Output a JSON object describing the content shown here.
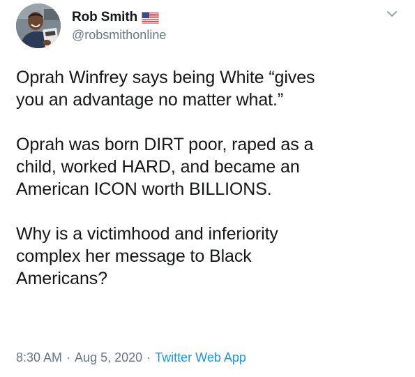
{
  "author": {
    "display_name": "Rob Smith",
    "handle": "@robsmithonline",
    "badge_icon": "us-flag-icon",
    "avatar_icon": "profile-photo"
  },
  "menu_icon": "chevron-down-icon",
  "tweet": {
    "paragraphs": [
      "Oprah Winfrey says being White “gives\nyou an advantage no matter what.”",
      "Oprah was born DIRT poor, raped as a\nchild, worked HARD, and became an\nAmerican ICON worth BILLIONS.",
      "Why is a victimhood and inferiority\ncomplex her message to Black\nAmericans?"
    ]
  },
  "meta": {
    "time": "8:30 AM",
    "separator": "·",
    "date": "Aug 5, 2020",
    "source": "Twitter Web App"
  },
  "colors": {
    "text": "#14171a",
    "muted": "#657786",
    "link": "#1b95e0"
  }
}
